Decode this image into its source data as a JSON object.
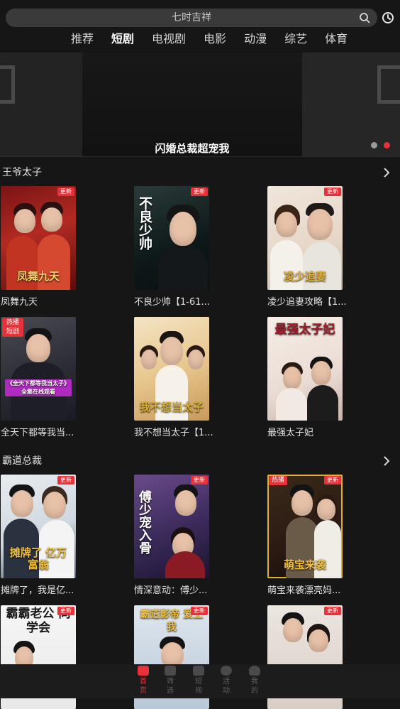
{
  "search": {
    "placeholder": "七时吉祥"
  },
  "tabs": [
    {
      "label": "推荐"
    },
    {
      "label": "短剧",
      "active": true
    },
    {
      "label": "电视剧"
    },
    {
      "label": "电影"
    },
    {
      "label": "动漫"
    },
    {
      "label": "综艺"
    },
    {
      "label": "体育"
    }
  ],
  "banner": {
    "title": "闪婚总裁超宠我",
    "pages": 2,
    "current_page": 2
  },
  "sections": [
    {
      "title": "王爷太子",
      "items": [
        {
          "caption": "凤舞九天",
          "badge": "更新",
          "poster_text": "凤舞九天"
        },
        {
          "caption": "不良少帅【1-61...",
          "badge": "更新",
          "poster_text": "不良少帅"
        },
        {
          "caption": "凌少追妻攻略【1...",
          "badge": "更新",
          "poster_text": "凌少追妻"
        },
        {
          "caption": "全天下都等我当...",
          "badge_left": "热播 短剧",
          "poster_text": "《全天下都等我当太子》 全集在线观看"
        },
        {
          "caption": "我不想当太子【1...",
          "poster_text": "我不想当太子"
        },
        {
          "caption": "最强太子妃",
          "poster_text": "最强太子妃"
        }
      ]
    },
    {
      "title": "霸道总裁",
      "items": [
        {
          "caption": "摊牌了，我是亿...",
          "badge": "更新",
          "poster_text": "摊牌了 亿万富翁"
        },
        {
          "caption": "情深意动：傅少...",
          "badge": "更新",
          "poster_text": "傅少宠入骨"
        },
        {
          "caption": "萌宝来袭漂亮妈...",
          "badge": "更新",
          "badge_left": "热播",
          "poster_text": "萌宝来袭"
        },
        {
          "caption": "",
          "badge": "更新",
          "poster_text": "霸霸老公 同学会"
        },
        {
          "caption": "",
          "badge": "更新",
          "poster_text": "霸道影帝 爱上我"
        },
        {
          "caption": "",
          "badge": "更新",
          "poster_text": ""
        }
      ]
    }
  ],
  "bottom_nav": [
    {
      "label": "首页",
      "icon": "clapperboard-icon",
      "active": true
    },
    {
      "label": "筛选",
      "icon": "filter-icon"
    },
    {
      "label": "短视",
      "icon": "play-icon"
    },
    {
      "label": "活动",
      "icon": "activity-icon"
    },
    {
      "label": "我的",
      "icon": "profile-icon"
    }
  ],
  "colors": {
    "accent": "#e8323a",
    "background": "#161616"
  }
}
